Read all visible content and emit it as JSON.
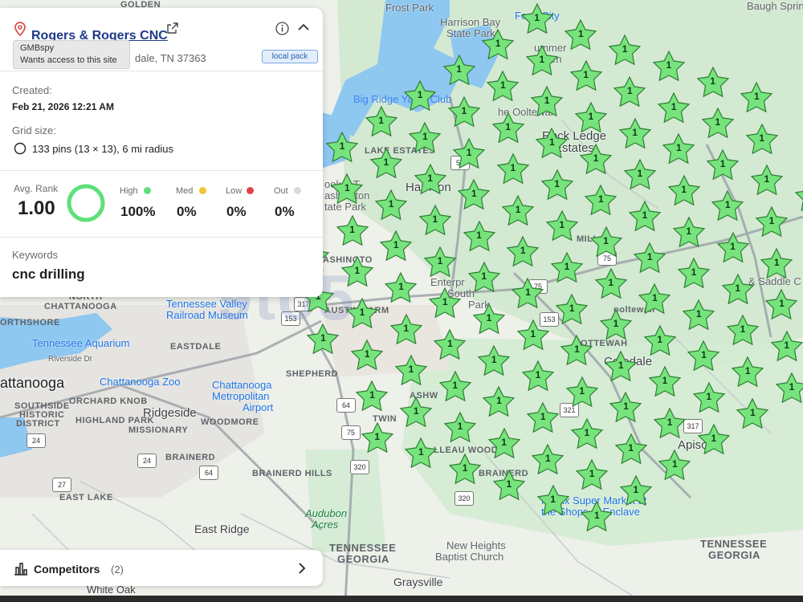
{
  "business": {
    "name": "Rogers & Rogers CNC",
    "address": "dale, TN 37363",
    "tooltip_title": "GMBspy",
    "tooltip_text": "Wants access to this site",
    "badge": "local pack"
  },
  "info": {
    "created_label": "Created:",
    "created_value": "Feb 21, 2026 12:21 AM",
    "grid_label": "Grid size:",
    "grid_value": "133 pins (13 × 13), 6 mi radius"
  },
  "stats": {
    "avg_rank_label": "Avg. Rank",
    "avg_rank_value": "1.00",
    "high_label": "High",
    "high_value": "100%",
    "med_label": "Med",
    "med_value": "0%",
    "low_label": "Low",
    "low_value": "0%",
    "out_label": "Out",
    "out_value": "0%",
    "high_fraction": 1.0
  },
  "keywords": {
    "label": "Keywords",
    "value": "cnc drilling"
  },
  "competitors": {
    "label": "Competitors",
    "count": "(2)"
  },
  "colors": {
    "high": "#5ee07a",
    "med": "#f4c430",
    "low": "#e0424b",
    "out": "#dadada",
    "pin_fill": "#77e37d",
    "pin_stroke": "#2e7d32"
  },
  "watermark": "9to5",
  "pin_rank": "1",
  "map_labels": {
    "golden": "GOLDEN",
    "frost_park": "Frost Park",
    "harrison_bay": "Harrison Bay",
    "state_park": "State Park",
    "food_city": "Food City",
    "baugh_springs": "Baugh Springs",
    "summer_haven_a": "ummer",
    "summer_haven_b": "Haven",
    "big_ridge": "Big Ridge Yacht Club",
    "oltewah": "he Ooltewah",
    "rock_ledge_a": "Rock Ledge",
    "rock_ledge_b": "Estates",
    "lake_estates": "LAKE ESTATES",
    "booker_a": "ooker T.",
    "booker_b": "ashington",
    "booker_c": "tate Park",
    "harrison": "Harrison",
    "mill": "MILL",
    "high_a": "Hi",
    "high_b": "& Saddle C",
    "washington": "ASHINGTO",
    "north_chattanooga_a": "NORTH",
    "north_chattanooga_b": "CHATTANOOGA",
    "enterprise_a": "Enterpr",
    "enterprise_b": "South",
    "enterprise_c": "Park",
    "tn_valley_a": "Tennessee Valley",
    "tn_valley_b": "Railroad Museum",
    "austin_farm": "AUSTIN FARM",
    "ooltewah2": "ooltewah",
    "northshore": "ORTHSHORE",
    "tn_aquarium": "Tennessee Aquarium",
    "eastdale": "EASTDALE",
    "oottewah": "OOTTEWAH",
    "collegedale": "Co    edale",
    "riverside": "Riverside Dr",
    "shepherd": "SHEPHERD",
    "chattanooga": "attanooga",
    "chatt_zoo": "Chattanooga Zoo",
    "chatt_airport_a": "Chattanooga",
    "chatt_airport_b": "Metropolitan",
    "chatt_airport_c": "Airport",
    "orchard_knob": "ORCHARD KNOB",
    "southside_a": "SOUTHSIDE",
    "southside_b": "HISTORIC",
    "southside_c": "DISTRICT",
    "ridgeside": "Ridgeside",
    "woodmore": "WOODMORE",
    "highland_park_a": "HIGHLAND PARK",
    "missionary": "MISSIONARY",
    "ashwood": "ASHW",
    "twin": "TWIN",
    "apison": "Apiso",
    "brainerd": "BRAINERD",
    "lleau_woods": "LLEAU WOODS",
    "brainerd_hills": "BRAINERD HILLS",
    "brainerd2": "BRAINERD",
    "east_lake": "EAST LAKE",
    "publix_a": "Publix Super Market at",
    "publix_b": "the Shops at Enclave",
    "audubon_a": "Audubon",
    "audubon_b": "Acres",
    "east_ridge": "East Ridge",
    "new_heights_a": "New Heights",
    "new_heights_b": "Baptist Church",
    "tn_a": "TENNESSEE",
    "ga_a": "GEORGIA",
    "tn_b": "TENNESSEE",
    "ga_b": "GEORGIA",
    "graysville": "Graysville",
    "white_oak": "White Oak"
  },
  "route_shields": [
    "58",
    "75",
    "317",
    "153",
    "64",
    "75",
    "321",
    "317",
    "24",
    "24",
    "27",
    "64",
    "320",
    "320",
    "75",
    "153"
  ]
}
